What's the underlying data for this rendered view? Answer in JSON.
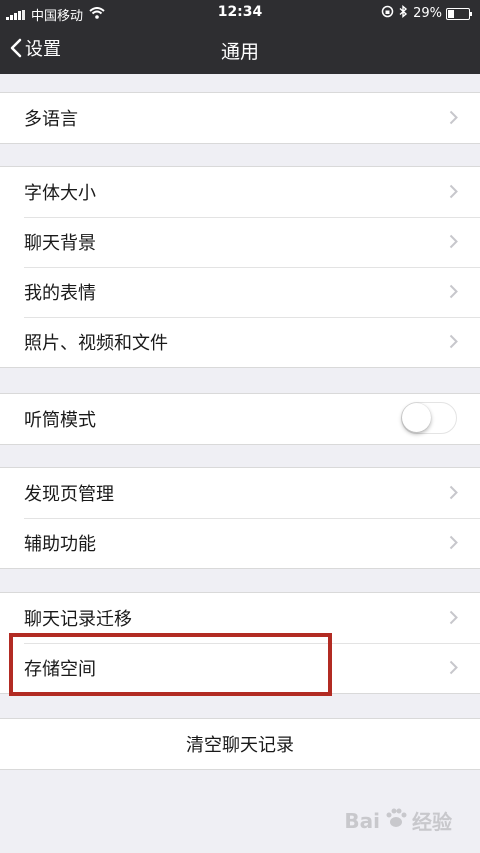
{
  "status_bar": {
    "carrier": "中国移动",
    "time": "12:34",
    "battery_percent": "29%",
    "battery_level": 0.29
  },
  "nav_bar": {
    "back_label": "设置",
    "title": "通用"
  },
  "sections": [
    {
      "items": [
        {
          "label": "多语言"
        }
      ]
    },
    {
      "items": [
        {
          "label": "字体大小"
        },
        {
          "label": "聊天背景"
        },
        {
          "label": "我的表情"
        },
        {
          "label": "照片、视频和文件"
        }
      ]
    },
    {
      "items": [
        {
          "label": "听筒模式",
          "toggle_on": false
        }
      ]
    },
    {
      "items": [
        {
          "label": "发现页管理"
        },
        {
          "label": "辅助功能"
        }
      ]
    },
    {
      "items": [
        {
          "label": "聊天记录迁移"
        },
        {
          "label": "存储空间"
        }
      ]
    }
  ],
  "clear_action": {
    "label": "清空聊天记录"
  },
  "watermark": {
    "text_left": "Bai",
    "text_right": "经验"
  },
  "colors": {
    "bar": "#2e2e31",
    "background": "#efeff4",
    "highlight": "#b22b23"
  }
}
